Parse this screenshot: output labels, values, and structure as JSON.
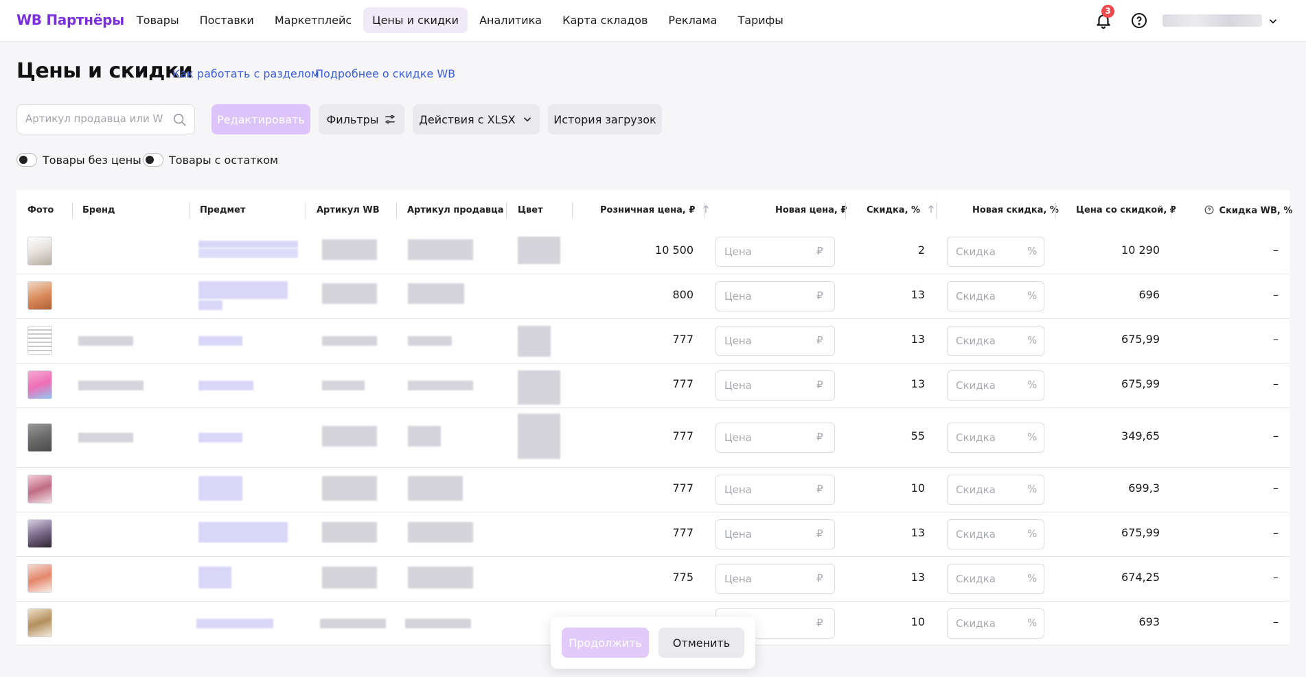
{
  "header": {
    "logo": "WB Партнёры",
    "nav": [
      "Товары",
      "Поставки",
      "Маркетплейс",
      "Цены и скидки",
      "Аналитика",
      "Карта складов",
      "Реклама",
      "Тарифы"
    ],
    "active_nav": "Цены и скидки",
    "notifications_count": "3"
  },
  "page": {
    "title": "Цены и скидки",
    "link_how": "Как работать с разделом",
    "link_discount": "Подробнее о скидке WB"
  },
  "toolbar": {
    "search_placeholder": "Артикул продавца или WB",
    "edit_label": "Редактировать",
    "filters_label": "Фильтры",
    "xlsx_label": "Действия с XLSX",
    "history_label": "История загрузок"
  },
  "toggles": {
    "no_price": "Товары без цены",
    "with_stock": "Товары с остатком"
  },
  "table": {
    "columns": {
      "photo": "Фото",
      "brand": "Бренд",
      "subject": "Предмет",
      "article_wb": "Артикул WB",
      "article_seller": "Артикул продавца",
      "color": "Цвет",
      "retail_price": "Розничная цена, ₽",
      "new_price": "Новая цена, ₽",
      "discount": "Скидка, %",
      "new_discount": "Новая скидка, %",
      "discounted_price": "Цена со скидкой, ₽",
      "wb_discount": "Скидка WB, %"
    },
    "price_placeholder": "Цена",
    "price_unit": "₽",
    "discount_placeholder": "Скидка",
    "discount_unit": "%",
    "rows": [
      {
        "retail": "10 500",
        "discount": "2",
        "discounted": "10 290",
        "wb": "–"
      },
      {
        "retail": "800",
        "discount": "13",
        "discounted": "696",
        "wb": "–"
      },
      {
        "retail": "777",
        "discount": "13",
        "discounted": "675,99",
        "wb": "–"
      },
      {
        "retail": "777",
        "discount": "13",
        "discounted": "675,99",
        "wb": "–"
      },
      {
        "retail": "777",
        "discount": "55",
        "discounted": "349,65",
        "wb": "–"
      },
      {
        "retail": "777",
        "discount": "10",
        "discounted": "699,3",
        "wb": "–"
      },
      {
        "retail": "777",
        "discount": "13",
        "discounted": "675,99",
        "wb": "–"
      },
      {
        "retail": "775",
        "discount": "13",
        "discounted": "674,25",
        "wb": "–"
      },
      {
        "retail": "",
        "discount": "10",
        "discounted": "693",
        "wb": "–"
      }
    ]
  },
  "actions": {
    "continue_label": "Продолжить",
    "cancel_label": "Отменить"
  },
  "colors": {
    "brand": "#7a2ee0",
    "link": "#3c5fd6",
    "primary_disabled": "#dcc4fb",
    "badge": "#f0474c"
  }
}
